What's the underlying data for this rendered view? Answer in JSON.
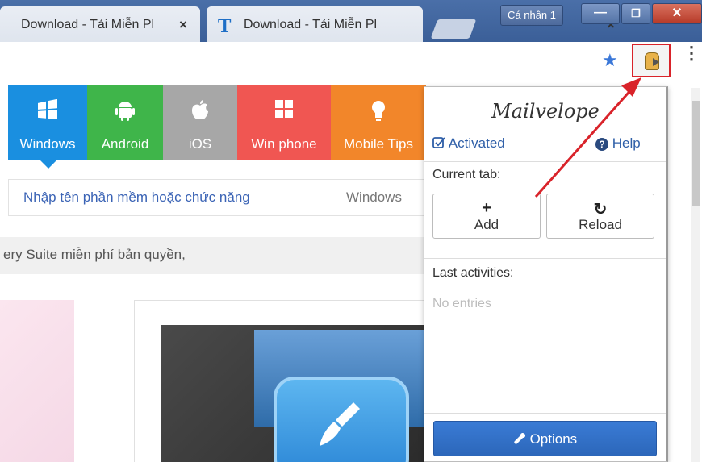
{
  "browser": {
    "tabs": [
      {
        "title": "Download - Tải Miễn Pl",
        "close": "×"
      },
      {
        "favicon": "T",
        "title": "Download - Tải Miễn Pl",
        "close": "×"
      }
    ],
    "profile": "Cá nhân 1",
    "window": {
      "minimize": "—",
      "maximize": "❐",
      "close": "✕"
    },
    "toolbar": {
      "bookmark_icon": "★",
      "menu_icon": "⋮"
    }
  },
  "page": {
    "categories": [
      {
        "label": "Windows",
        "icon": "windows-icon",
        "color": "#1a8fe0"
      },
      {
        "label": "Android",
        "icon": "android-icon",
        "color": "#3fb54a"
      },
      {
        "label": "iOS",
        "icon": "apple-icon",
        "color": "#a7a7a7"
      },
      {
        "label": "Win phone",
        "icon": "windows-phone-icon",
        "color": "#f05652"
      },
      {
        "label": "Mobile Tips",
        "icon": "lightbulb-icon",
        "color": "#f2862a"
      }
    ],
    "search": {
      "placeholder": "Nhập tên phần mềm hoặc chức năng",
      "scope": "Windows"
    },
    "notice": "ery Suite miễn phí bản quyền,"
  },
  "popup": {
    "brand": "Mailvelope",
    "activated": "Activated",
    "help": "Help",
    "current_tab": "Current tab:",
    "add": {
      "symbol": "+",
      "label": "Add"
    },
    "reload": {
      "symbol": "↻",
      "label": "Reload"
    },
    "last_activities": "Last activities:",
    "no_entries": "No entries",
    "options": "Options",
    "options_icon": "🔧"
  },
  "colors": {
    "highlight": "#d9232a",
    "accent": "#2c67ba"
  }
}
